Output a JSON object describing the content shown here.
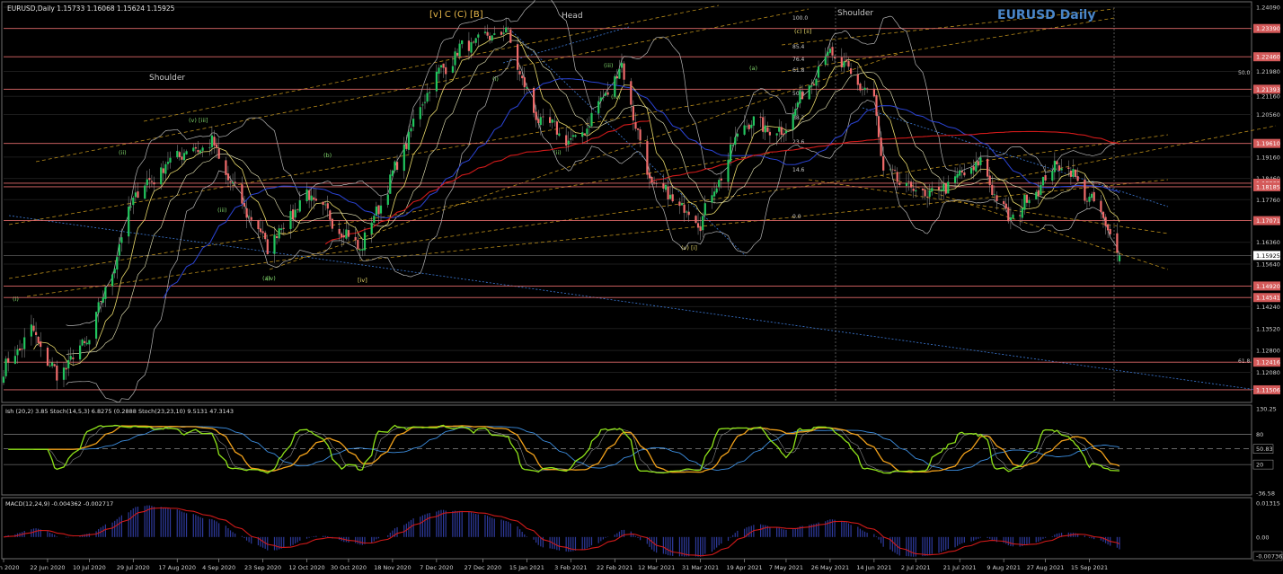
{
  "window": {
    "symbol_line": "EURUSD,Daily  1.15733 1.16068 1.15624 1.15925",
    "chart_title": "EURUSD Daily",
    "chart_title_color": "#4a86c8"
  },
  "annotations": {
    "head": "Head",
    "shoulder_left": "Shoulder",
    "shoulder_right": "Shoulder",
    "top_wave_label": "[v] C (C) [B]",
    "wave_labels": [
      "(i)",
      "(ii)",
      "(iii)",
      "(iv)",
      "(v) [iii]",
      "(a)",
      "(b)",
      "[iv]",
      "(i)",
      "(ii)",
      "(iii)",
      "(iv)",
      "(v) [i]",
      "(a)",
      "(c) [ii]"
    ],
    "fib_levels": [
      "100.0",
      "85.4",
      "76.4",
      "61.8",
      "50.0",
      "38.2",
      "23.6",
      "14.6",
      "0.0"
    ],
    "fib_right": [
      "50.0",
      "61.8"
    ]
  },
  "colors": {
    "background": "#000000",
    "grid": "#4a4a4a",
    "bull_candle": "#22c55e",
    "bear_candle": "#ef6b6b",
    "sma_red": "#d11a1a",
    "sma_blue": "#2b44d6",
    "bollinger": "#b5b5b5",
    "ema_yellow": "#e8d96a",
    "hline": "#e06a6a",
    "trend_dashed": "#d9a520",
    "fib_dotted": "#3d7bd9",
    "stoch_main": "#8fe31a",
    "stoch_signal": "#f2a11a",
    "stoch_slow": "#3c8ee0",
    "macd_hist": "#2e3a9c",
    "macd_signal": "#d11a1a",
    "price_label_bg": "#d45a5a",
    "current_price_bg": "#ffffff"
  },
  "price_axis": {
    "ticks": [
      "1.24090",
      "1.23390",
      "1.22460",
      "1.21980",
      "1.21393",
      "1.21160",
      "1.20560",
      "1.19610",
      "1.19160",
      "1.18302",
      "1.18460",
      "1.18185",
      "1.17760",
      "1.17071",
      "1.16360",
      "1.15925",
      "1.15640",
      "1.14920",
      "1.14541",
      "1.14240",
      "1.13520",
      "1.12800",
      "1.12416",
      "1.12080",
      "1.11506"
    ],
    "levels": [
      {
        "label": "1.23390",
        "value": 1.2339,
        "kind": "level"
      },
      {
        "label": "1.22460",
        "value": 1.2246,
        "kind": "level"
      },
      {
        "label": "1.21393",
        "value": 1.21393,
        "kind": "level"
      },
      {
        "label": "1.19610",
        "value": 1.1961,
        "kind": "level"
      },
      {
        "label": "1.18302",
        "value": 1.18302,
        "kind": "level"
      },
      {
        "label": "1.18185",
        "value": 1.18185,
        "kind": "level"
      },
      {
        "label": "1.17071",
        "value": 1.17071,
        "kind": "level"
      },
      {
        "label": "1.15925",
        "value": 1.15925,
        "kind": "current"
      },
      {
        "label": "1.14920",
        "value": 1.1492,
        "kind": "level"
      },
      {
        "label": "1.14541",
        "value": 1.14541,
        "kind": "level"
      },
      {
        "label": "1.12416",
        "value": 1.12416,
        "kind": "level"
      },
      {
        "label": "1.11506",
        "value": 1.11506,
        "kind": "level"
      }
    ],
    "plain_ticks": [
      {
        "label": "1.24090",
        "value": 1.2409
      },
      {
        "label": "1.21980",
        "value": 1.2198
      },
      {
        "label": "1.21160",
        "value": 1.2116
      },
      {
        "label": "1.20560",
        "value": 1.2056
      },
      {
        "label": "1.19160",
        "value": 1.1916
      },
      {
        "label": "1.18460",
        "value": 1.1846
      },
      {
        "label": "1.17760",
        "value": 1.1776
      },
      {
        "label": "1.16360",
        "value": 1.1636
      },
      {
        "label": "1.15640",
        "value": 1.1564
      },
      {
        "label": "1.14240",
        "value": 1.1424
      },
      {
        "label": "1.13520",
        "value": 1.1352
      },
      {
        "label": "1.12800",
        "value": 1.128
      },
      {
        "label": "1.12080",
        "value": 1.1208
      }
    ]
  },
  "time_axis": {
    "labels": [
      "3 Jun 2020",
      "22 Jun 2020",
      "10 Jul 2020",
      "29 Jul 2020",
      "17 Aug 2020",
      "4 Sep 2020",
      "23 Sep 2020",
      "12 Oct 2020",
      "30 Oct 2020",
      "18 Nov 2020",
      "7 Dec 2020",
      "27 Dec 2020",
      "15 Jan 2021",
      "3 Feb 2021",
      "22 Feb 2021",
      "12 Mar 2021",
      "31 Mar 2021",
      "19 Apr 2021",
      "7 May 2021",
      "26 May 2021",
      "14 Jun 2021",
      "2 Jul 2021",
      "21 Jul 2021",
      "9 Aug 2021",
      "27 Aug 2021",
      "15 Sep 2021"
    ]
  },
  "stochastic_panel": {
    "header": "Ish (20,2) 3.85  Stoch(14,5,3) 6.8275 (0.2888  Stoch(23,23,10) 9.5131 47.3143",
    "axis_ticks": [
      "130.25",
      "80",
      "50.83",
      "20",
      "-36.58"
    ],
    "axis_values": [
      130.25,
      80,
      50.83,
      20,
      -36.58
    ]
  },
  "macd_panel": {
    "header": "MACD(12,24,9) -0.004362 -0.002717",
    "axis_ticks": [
      "0.01315",
      "0.00",
      "-0.007362"
    ],
    "axis_values": [
      0.01315,
      0.0,
      -0.007362
    ]
  },
  "chart_data": {
    "type": "candlestick",
    "title": "EURUSD Daily",
    "ylim": [
      1.1115,
      1.2415
    ],
    "x_range": [
      "3 Jun 2020",
      "28 Sep 2021"
    ],
    "anchors": [
      {
        "date": "3 Jun 2020",
        "price": 1.1215
      },
      {
        "date": "15 Jun 2020",
        "price": 1.1345
      },
      {
        "date": "26 Jun 2020",
        "price": 1.1195
      },
      {
        "date": "10 Jul 2020",
        "price": 1.132
      },
      {
        "date": "22 Jul 2020",
        "price": 1.1595
      },
      {
        "date": "29 Jul 2020",
        "price": 1.1785
      },
      {
        "date": "17 Aug 2020",
        "price": 1.1925
      },
      {
        "date": "1 Sep 2020",
        "price": 1.196
      },
      {
        "date": "10 Sep 2020",
        "price": 1.1815
      },
      {
        "date": "25 Sep 2020",
        "price": 1.1625
      },
      {
        "date": "12 Oct 2020",
        "price": 1.1795
      },
      {
        "date": "4 Nov 2020",
        "price": 1.1615
      },
      {
        "date": "18 Nov 2020",
        "price": 1.1855
      },
      {
        "date": "4 Dec 2020",
        "price": 1.2155
      },
      {
        "date": "17 Dec 2020",
        "price": 1.227
      },
      {
        "date": "6 Jan 2021",
        "price": 1.2335
      },
      {
        "date": "18 Jan 2021",
        "price": 1.2055
      },
      {
        "date": "5 Feb 2021",
        "price": 1.196
      },
      {
        "date": "25 Feb 2021",
        "price": 1.2215
      },
      {
        "date": "9 Mar 2021",
        "price": 1.1835
      },
      {
        "date": "31 Mar 2021",
        "price": 1.1705
      },
      {
        "date": "19 Apr 2021",
        "price": 1.2035
      },
      {
        "date": "5 May 2021",
        "price": 1.1995
      },
      {
        "date": "25 May 2021",
        "price": 1.2265
      },
      {
        "date": "14 Jun 2021",
        "price": 1.2105
      },
      {
        "date": "18 Jun 2021",
        "price": 1.1865
      },
      {
        "date": "7 Jul 2021",
        "price": 1.1785
      },
      {
        "date": "30 Jul 2021",
        "price": 1.1895
      },
      {
        "date": "11 Aug 2021",
        "price": 1.1705
      },
      {
        "date": "3 Sep 2021",
        "price": 1.1905
      },
      {
        "date": "20 Sep 2021",
        "price": 1.1725
      },
      {
        "date": "28 Sep 2021",
        "price": 1.1593
      }
    ],
    "last": {
      "open": 1.15733,
      "high": 1.16068,
      "low": 1.15624,
      "close": 1.15925
    },
    "grid": true
  }
}
